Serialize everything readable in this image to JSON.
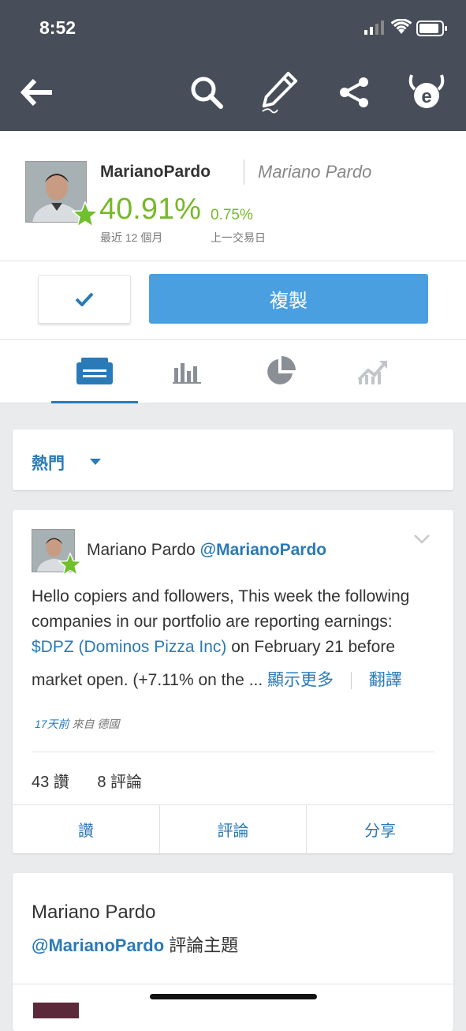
{
  "status": {
    "time": "8:52"
  },
  "appbar": {
    "icons": [
      "back-arrow-icon",
      "search-icon",
      "edit-pencil-icon",
      "share-icon",
      "etoro-logo-icon"
    ]
  },
  "profile": {
    "username": "MarianoPardo",
    "fullname": "Mariano Pardo",
    "gain_12m": "40.91%",
    "gain_12m_label": "最近 12 個月",
    "gain_day": "0.75%",
    "gain_day_label": "上一交易日"
  },
  "actions": {
    "copy_label": "複製"
  },
  "tabs": [
    "feed-tab",
    "stats-tab",
    "portfolio-tab",
    "chart-tab"
  ],
  "filter": {
    "label": "熱門"
  },
  "post": {
    "author_name": "Mariano Pardo",
    "author_handle": "@MarianoPardo",
    "text_part1": "Hello copiers and followers, This week the following companies in our portfolio are reporting earnings: ",
    "text_link": "$DPZ (Dominos Pizza Inc)",
    "text_part2": " on February 21 before",
    "text_line4": "market open. (+7.11% on the ...",
    "show_more": "顯示更多",
    "translate": "翻譯",
    "time_ago": "17天前",
    "location": "來自 德國",
    "likes": "43 讚",
    "comments": "8 評論",
    "btn_like": "讚",
    "btn_comment": "評論",
    "btn_share": "分享"
  },
  "post2": {
    "name": "Mariano Pardo",
    "handle": "@MarianoPardo",
    "suffix": " 評論主題"
  },
  "colors": {
    "bar": "#474e59",
    "accent": "#2a7ab8",
    "green": "#78b82a",
    "button": "#4a9fe0"
  }
}
